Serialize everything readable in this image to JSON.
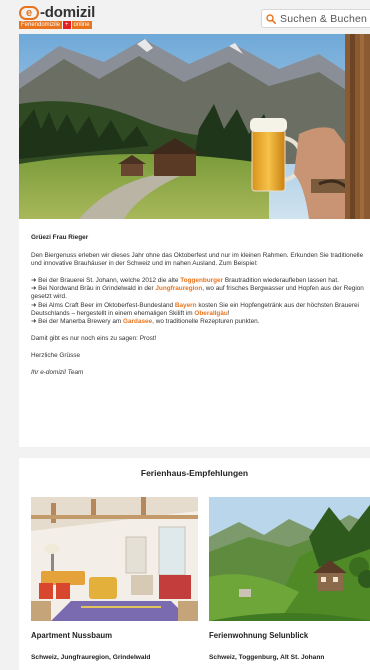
{
  "header": {
    "logo_text": "-domizil",
    "logo_letter": "e",
    "logo_sub": [
      "Feriendomizile",
      "+",
      "online"
    ],
    "search_label": "Suchen & Buchen"
  },
  "hero": {
    "alt": "mountain-valley-with-beer-glass"
  },
  "letter": {
    "greeting": "Grüezi Frau Rieger",
    "intro": "Den Biergenuss erleben wir dieses Jahr ohne das Oktoberfest und nur im kleinen Rahmen. Erkunden Sie traditionelle und innovative Brauhäuser in der Schweiz und im nahen Ausland. Zum Beispiel:",
    "bullets": [
      {
        "pre": "➜ Bei der Brauerei St. Johann, welche 2012 die alte ",
        "hl": "Toggenburger",
        "post": " Brautradition wiederaufleben lassen hat."
      },
      {
        "pre": "➜ Bei Nordwand Bräu in Grindelwald in der ",
        "hl": "Jungfrauregion",
        "post": ", wo auf frisches Bergwasser und Hopfen aus der Region gesetzt wird."
      },
      {
        "pre": "➜ Bei Alms Craft Beer im Oktoberfest-Bundesland ",
        "hl": "Bayern",
        "post": " kosten Sie ein Hopfengetränk aus der höchsten Brauerei Deutschlands – hergestellt in einem ehemaligen Skilift im ",
        "hl2": "Oberallgäu",
        "post2": "!"
      },
      {
        "pre": "➜ Bei der Manerba Brewery am ",
        "hl": "Gardasee",
        "post": ", wo traditionelle Rezepturen punkten."
      }
    ],
    "closing": "Damit gibt es nur noch eins zu sagen: Prost!",
    "regards": "Herzliche Grüsse",
    "signature": "Ihr e-domizil Team"
  },
  "recommendations": {
    "title": "Ferienhaus-Empfehlungen",
    "cards": [
      {
        "name": "Apartment Nussbaum",
        "location": "Schweiz, Jungfrauregion, Grindelwald"
      },
      {
        "name": "Ferienwohnung Selunblick",
        "location": "Schweiz, Toggenburg, Alt St. Johann"
      }
    ]
  },
  "colors": {
    "accent": "#e8741e",
    "brand_red": "#e31e24",
    "background": "#f2f2f2"
  }
}
